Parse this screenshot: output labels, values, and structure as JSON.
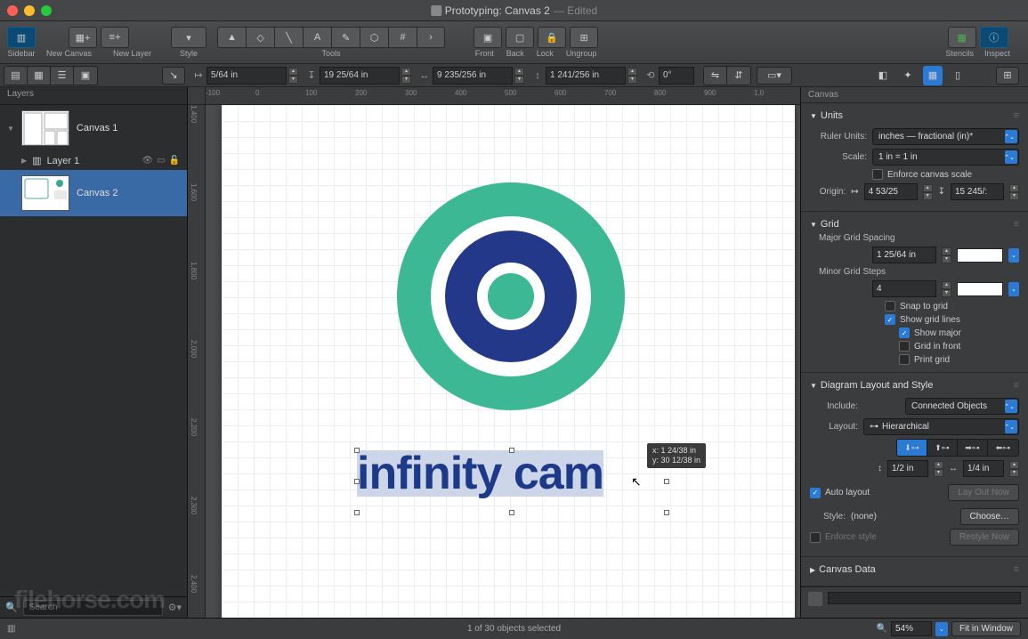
{
  "title": {
    "doc": "Prototyping: Canvas 2",
    "edited": "— Edited"
  },
  "toolbar": {
    "sidebar": "Sidebar",
    "new_canvas": "New Canvas",
    "new_layer": "New Layer",
    "style": "Style",
    "tools": "Tools",
    "front": "Front",
    "back": "Back",
    "lock": "Lock",
    "ungroup": "Ungroup",
    "stencils": "Stencils",
    "inspect": "Inspect"
  },
  "measure": {
    "x": "5/64 in",
    "y": "19 25/64 in",
    "w": "9 235/256 in",
    "h": "1 241/256 in",
    "rot": "0°"
  },
  "sidebar": {
    "header": "Layers",
    "canvas1": "Canvas 1",
    "layer1": "Layer 1",
    "canvas2": "Canvas 2",
    "search_placeholder": "Search"
  },
  "rulers": {
    "h": [
      "-100",
      "0",
      "100",
      "200",
      "300",
      "400",
      "500",
      "600",
      "700",
      "800",
      "900",
      "1,0"
    ],
    "v": [
      "1,400",
      "1,600",
      "1,800",
      "2,000",
      "2,200",
      "2,300",
      "2,400"
    ]
  },
  "canvas": {
    "text": "infinity cam",
    "tip_x": "x: 1 24/38 in",
    "tip_y": "y: 30 12/38 in"
  },
  "inspector": {
    "header": "Canvas",
    "units": {
      "title": "Units",
      "ruler_units_label": "Ruler Units:",
      "ruler_units": "inches — fractional (in)*",
      "scale_label": "Scale:",
      "scale": "1 in = 1 in",
      "enforce": "Enforce canvas scale",
      "origin_label": "Origin:",
      "origin_x": "4 53/25",
      "origin_y": "15 245/:"
    },
    "grid": {
      "title": "Grid",
      "major_spacing_label": "Major Grid Spacing",
      "major_spacing": "1 25/64 in",
      "minor_steps_label": "Minor Grid Steps",
      "minor_steps": "4",
      "snap": "Snap to grid",
      "show_lines": "Show grid lines",
      "show_major": "Show major",
      "grid_in_front": "Grid in front",
      "print_grid": "Print grid"
    },
    "layout": {
      "title": "Diagram Layout and Style",
      "include_label": "Include:",
      "include": "Connected Objects",
      "layout_label": "Layout:",
      "layout": "Hierarchical",
      "spacing_v": "1/2 in",
      "spacing_h": "1/4 in",
      "auto_layout": "Auto layout",
      "lay_out_now": "Lay Out Now",
      "style_label": "Style:",
      "style": "(none)",
      "choose": "Choose…",
      "enforce_style": "Enforce style",
      "restyle": "Restyle Now"
    },
    "canvas_data": {
      "title": "Canvas Data"
    }
  },
  "status": {
    "selection": "1 of 30 objects selected",
    "zoom": "54%",
    "fit": "Fit in Window"
  },
  "watermark": "filehorse.com"
}
